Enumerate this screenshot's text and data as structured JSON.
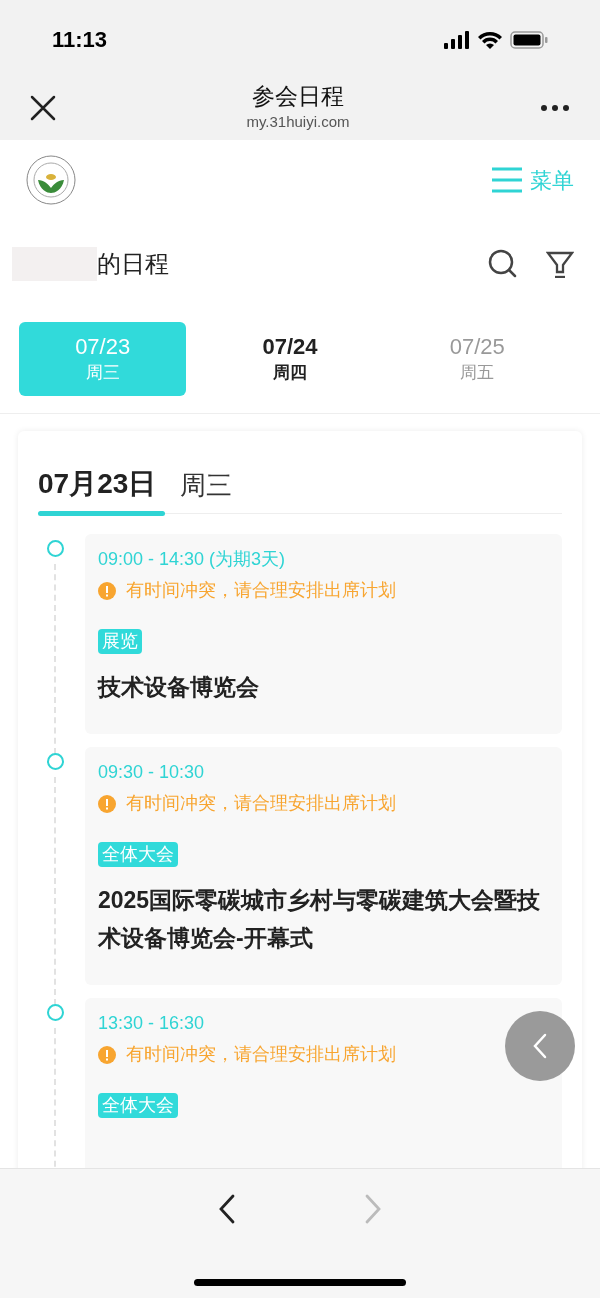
{
  "status_bar": {
    "time": "11:13"
  },
  "nav_bar": {
    "title": "参会日程",
    "url": "my.31huiyi.com"
  },
  "header": {
    "menu_label": "菜单"
  },
  "page_title": "的日程",
  "date_tabs": [
    {
      "date": "07/23",
      "weekday": "周三",
      "selected": true,
      "disabled": false
    },
    {
      "date": "07/24",
      "weekday": "周四",
      "selected": false,
      "disabled": false
    },
    {
      "date": "07/25",
      "weekday": "周五",
      "selected": false,
      "disabled": true
    }
  ],
  "day_heading": {
    "date": "07月23日",
    "weekday": "周三"
  },
  "events": [
    {
      "time": "09:00 - 14:30 (为期3天)",
      "warning": "有时间冲突，请合理安排出席计划",
      "tag": "展览",
      "title": "技术设备博览会"
    },
    {
      "time": "09:30 - 10:30",
      "warning": "有时间冲突，请合理安排出席计划",
      "tag": "全体大会",
      "title": "2025国际零碳城市乡村与零碳建筑大会暨技术设备博览会-开幕式"
    },
    {
      "time": "13:30 - 16:30",
      "warning": "有时间冲突，请合理安排出席计划",
      "tag": "全体大会"
    }
  ],
  "browser_toolbar": {
    "back_disabled": false,
    "forward_disabled": true
  }
}
